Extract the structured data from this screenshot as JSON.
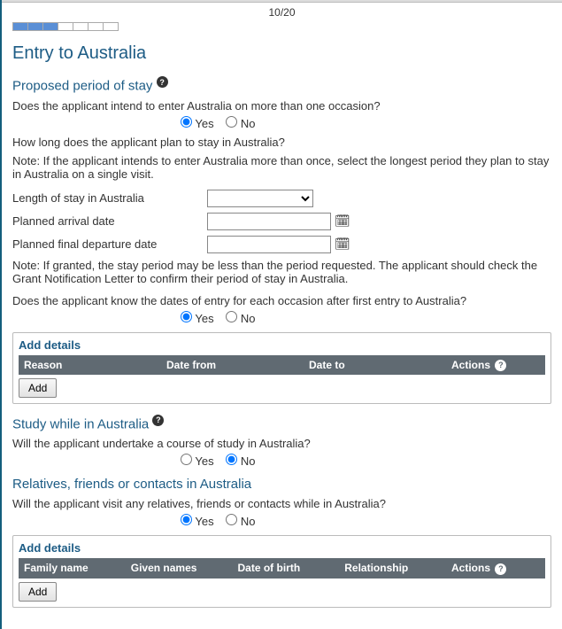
{
  "progress": {
    "step_label": "10/20",
    "filled_segments": 3,
    "total_segments": 7
  },
  "heading": "Entry to Australia",
  "period": {
    "title": "Proposed period of stay",
    "q_multiple": "Does the applicant intend to enter Australia on more than one occasion?",
    "yes": "Yes",
    "no": "No",
    "q_howlong": "How long does the applicant plan to stay in Australia?",
    "note1": "Note: If the applicant intends to enter Australia more than once, select the longest period they plan to stay in Australia on a single visit.",
    "length_label": "Length of stay in Australia",
    "arrival_label": "Planned arrival date",
    "departure_label": "Planned final departure date",
    "note2": "Note: If granted, the stay period may be less than the period requested. The applicant should check the Grant Notification Letter to confirm their period of stay in Australia.",
    "q_dates_known": "Does the applicant know the dates of entry for each occasion after first entry to Australia?"
  },
  "entries_table": {
    "title": "Add details",
    "col_reason": "Reason",
    "col_from": "Date from",
    "col_to": "Date to",
    "col_actions": "Actions",
    "add": "Add"
  },
  "study": {
    "title": "Study while in Australia",
    "q": "Will the applicant undertake a course of study in Australia?",
    "yes": "Yes",
    "no": "No"
  },
  "contacts": {
    "title": "Relatives, friends or contacts in Australia",
    "q": "Will the applicant visit any relatives, friends or contacts while in Australia?",
    "yes": "Yes",
    "no": "No"
  },
  "contacts_table": {
    "title": "Add details",
    "col_family": "Family name",
    "col_given": "Given names",
    "col_dob": "Date of birth",
    "col_rel": "Relationship",
    "col_actions": "Actions",
    "add": "Add"
  }
}
